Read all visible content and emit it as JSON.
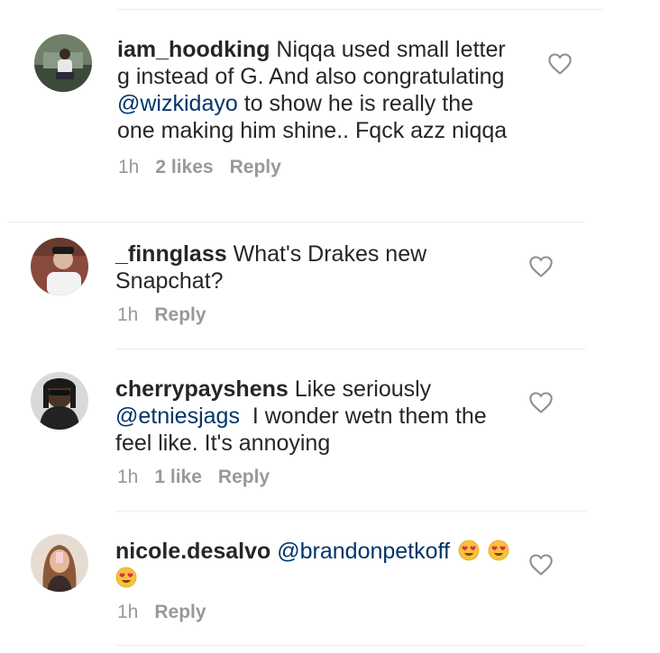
{
  "comments": [
    {
      "username": "iam_hoodking",
      "line1": "Niqqa used small letter",
      "line2": "g instead of G. And also congratulating",
      "line3_mention": "@wizkidayo",
      "line3_rest": " to show he is really the",
      "line4": "one making him shine.. Fqck azz niqqa",
      "time": "1h",
      "likes": "2 likes",
      "reply": "Reply"
    },
    {
      "username": "_finnglass",
      "line1": "What's Drakes new",
      "line2": "Snapchat?",
      "time": "1h",
      "reply": "Reply"
    },
    {
      "username": "cherrypayshens",
      "line1": "Like seriously",
      "line2_mention": "@etniesjags",
      "line2_rest": "  I wonder wetn them the",
      "line3": "feel like. It's annoying",
      "time": "1h",
      "likes": "1 like",
      "reply": "Reply"
    },
    {
      "username": "nicole.desalvo",
      "mention": "@brandonpetkoff",
      "time": "1h",
      "reply": "Reply"
    }
  ],
  "icons": {
    "heart": "heart-outline-icon",
    "emoji": "heart-eyes-emoji"
  },
  "colors": {
    "text": "#262626",
    "mention": "#003569",
    "meta": "#999999",
    "divider": "#ececec"
  }
}
